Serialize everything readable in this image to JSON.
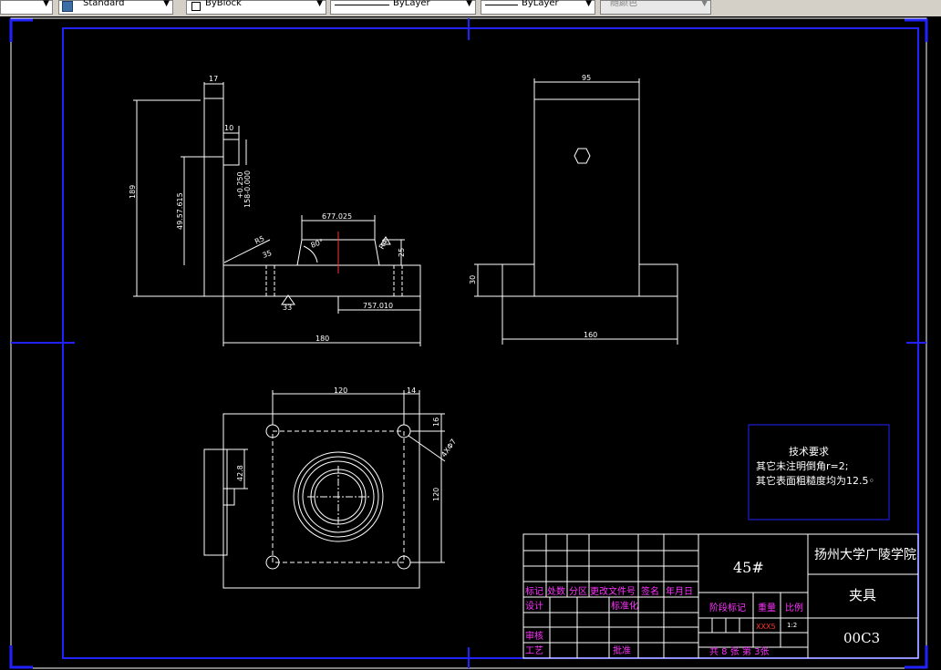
{
  "toolbar": {
    "text_style": "Standard",
    "layer": "ByBlock",
    "linetype": "ByLayer",
    "lineweight": "ByLayer",
    "color": "随颜色"
  },
  "dimensions": {
    "d17": "17",
    "d10": "10",
    "d189": "189",
    "tol_upper": "+0.250",
    "tol_lower": "158-0.000",
    "d49": "49.57.615",
    "r5": "R5",
    "d677": "677.025",
    "a80": "80°",
    "r1": "R4",
    "d25": "25",
    "s35": "35",
    "d757": "757.010",
    "s33": "33",
    "d180": "180",
    "d95": "95",
    "d30": "30",
    "d160": "160",
    "d120a": "120",
    "d14": "14",
    "d16": "16",
    "holes": "4XΦ7",
    "d42": "42.8",
    "d120b": "120"
  },
  "notes": {
    "title": "技术要求",
    "line1": "其它未注明倒角r=2;",
    "line2": "其它表面粗糙度均为12.5◦"
  },
  "title_block": {
    "material": "45#",
    "school": "扬州大学广陵学院",
    "part_name": "夹具",
    "drawing_no": "00C3",
    "h_mark": "标记",
    "h_count": "处数",
    "h_zone": "分区",
    "h_doc": "更改文件号",
    "h_sign": "签名",
    "h_date": "年月日",
    "design": "设计",
    "standard": "标准化",
    "stage": "阶段标记",
    "weight": "重量",
    "scale": "比例",
    "weight_val": "XXX5",
    "scale_val": "1:2",
    "review": "审核",
    "process": "工艺",
    "approve": "批准",
    "sheets": "共 8 张 第 3张"
  }
}
